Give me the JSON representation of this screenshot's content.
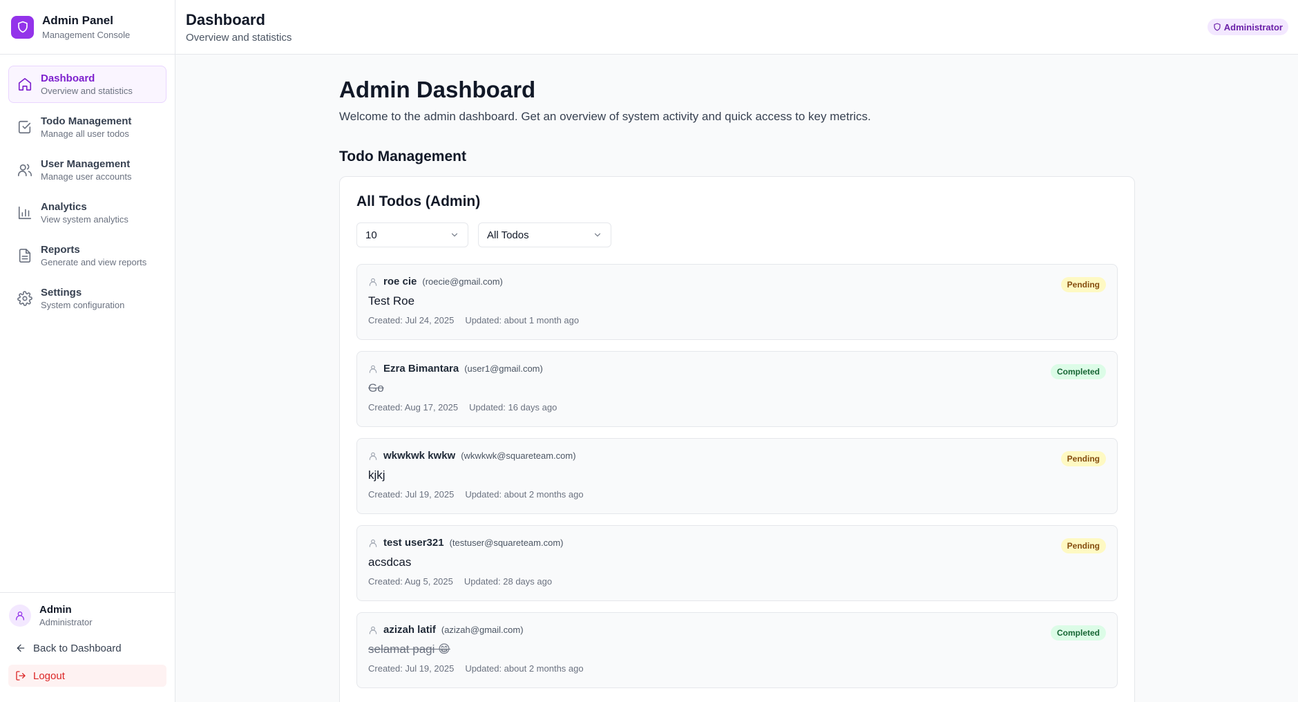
{
  "brand": {
    "title": "Admin Panel",
    "subtitle": "Management Console"
  },
  "nav": {
    "items": [
      {
        "label": "Dashboard",
        "desc": "Overview and statistics"
      },
      {
        "label": "Todo Management",
        "desc": "Manage all user todos"
      },
      {
        "label": "User Management",
        "desc": "Manage user accounts"
      },
      {
        "label": "Analytics",
        "desc": "View system analytics"
      },
      {
        "label": "Reports",
        "desc": "Generate and view reports"
      },
      {
        "label": "Settings",
        "desc": "System configuration"
      }
    ]
  },
  "user": {
    "name": "Admin",
    "role": "Administrator"
  },
  "footer": {
    "back_label": "Back to Dashboard",
    "logout_label": "Logout"
  },
  "topbar": {
    "title": "Dashboard",
    "subtitle": "Overview and statistics",
    "badge": "Administrator"
  },
  "page": {
    "title": "Admin Dashboard",
    "description": "Welcome to the admin dashboard. Get an overview of system activity and quick access to key metrics.",
    "section_title": "Todo Management"
  },
  "card": {
    "title": "All Todos (Admin)",
    "page_size": "10",
    "filter": "All Todos"
  },
  "todos": [
    {
      "user": "roe cie",
      "email": "(roecie@gmail.com)",
      "title": "Test Roe",
      "created": "Created: Jul 24, 2025",
      "updated": "Updated: about 1 month ago",
      "status": "Pending"
    },
    {
      "user": "Ezra Bimantara",
      "email": "(user1@gmail.com)",
      "title": "Go",
      "created": "Created: Aug 17, 2025",
      "updated": "Updated: 16 days ago",
      "status": "Completed"
    },
    {
      "user": "wkwkwk kwkw",
      "email": "(wkwkwk@squareteam.com)",
      "title": "kjkj",
      "created": "Created: Jul 19, 2025",
      "updated": "Updated: about 2 months ago",
      "status": "Pending"
    },
    {
      "user": "test user321",
      "email": "(testuser@squareteam.com)",
      "title": "acsdcas",
      "created": "Created: Aug 5, 2025",
      "updated": "Updated: 28 days ago",
      "status": "Pending"
    },
    {
      "user": "azizah latif",
      "email": "(azizah@gmail.com)",
      "title": "selamat pagi 😁",
      "created": "Created: Jul 19, 2025",
      "updated": "Updated: about 2 months ago",
      "status": "Completed"
    }
  ],
  "colors": {
    "accent": "#9333ea",
    "pending": "#fef9c3",
    "completed": "#dcfce7"
  }
}
